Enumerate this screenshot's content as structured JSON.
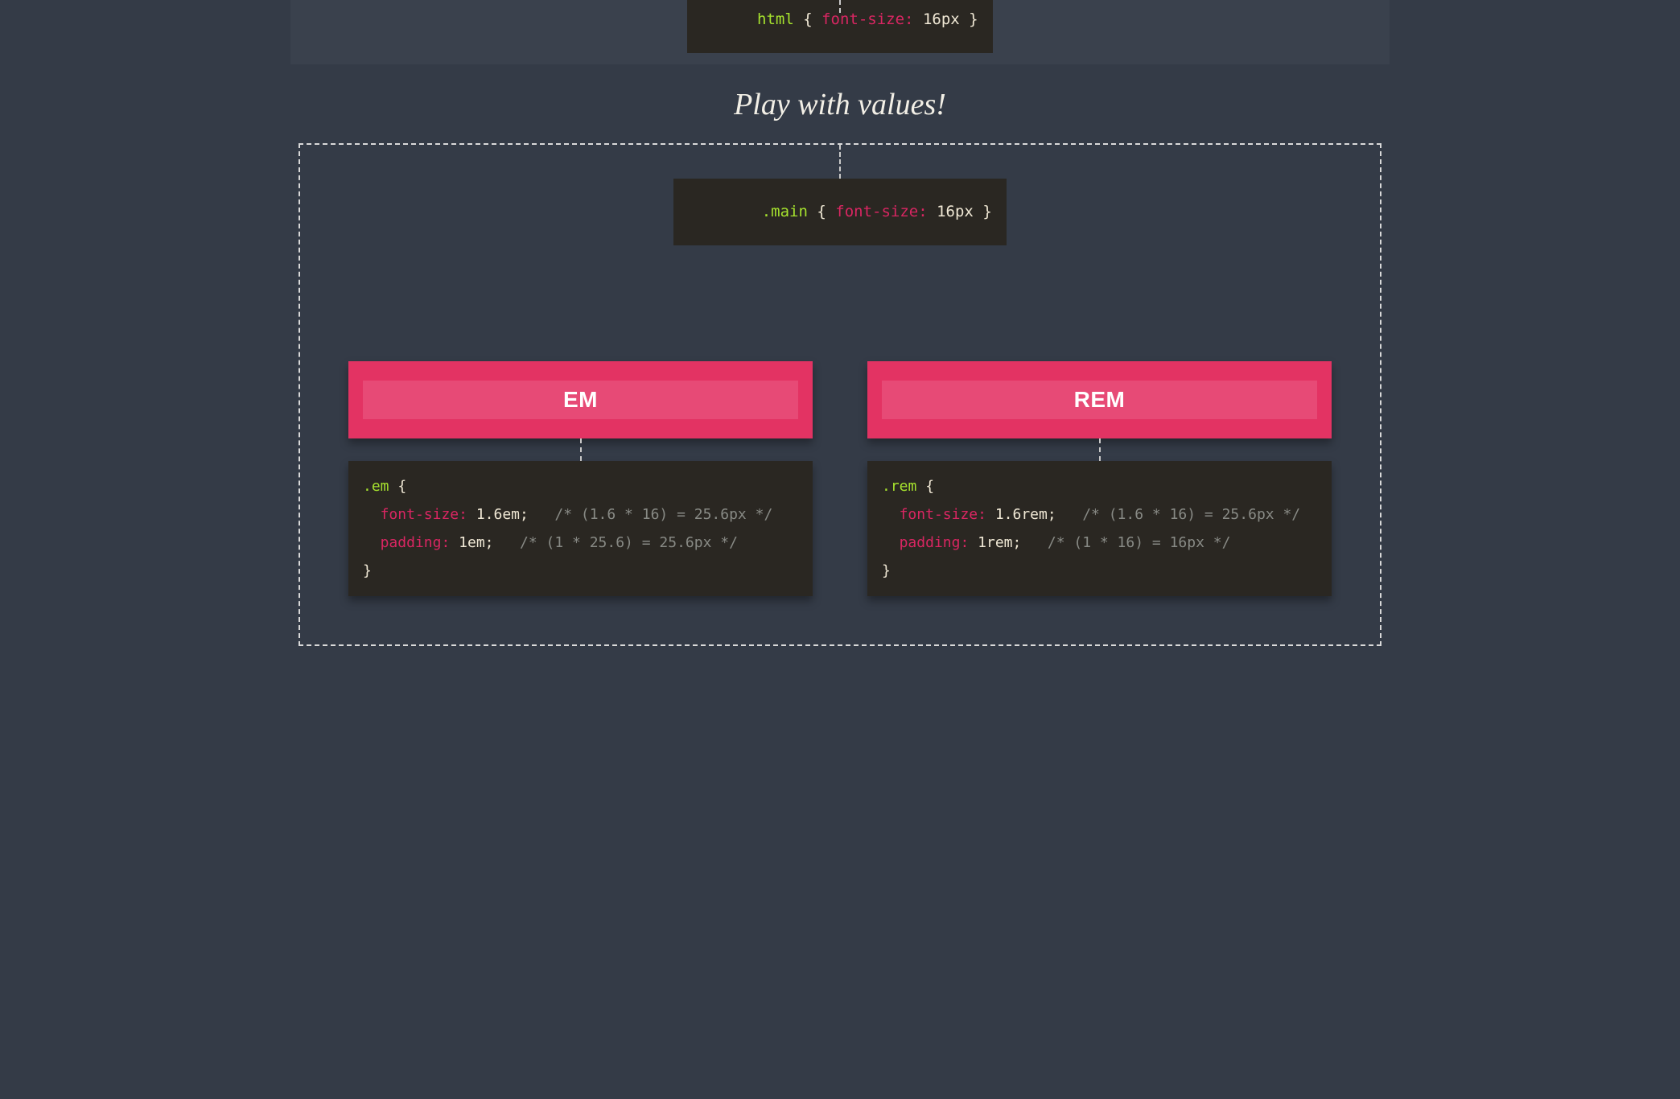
{
  "top_rule": {
    "selector": "html",
    "prop": "font-size:",
    "value": "16px"
  },
  "title": "Play with values!",
  "main_rule": {
    "selector": ".main",
    "prop": "font-size:",
    "value": "16px"
  },
  "em_card": {
    "label": "EM",
    "code": {
      "selector": ".em",
      "lines": [
        {
          "prop": "font-size:",
          "value": "1.6em",
          "comment": "/* (1.6 * 16) = 25.6px */"
        },
        {
          "prop": "padding:",
          "value": "1em",
          "comment": "/* (1 * 25.6) = 25.6px */"
        }
      ]
    }
  },
  "rem_card": {
    "label": "REM",
    "code": {
      "selector": ".rem",
      "lines": [
        {
          "prop": "font-size:",
          "value": "1.6rem",
          "comment": "/* (1.6 * 16) = 25.6px */"
        },
        {
          "prop": "padding:",
          "value": "1rem",
          "comment": "/* (1 * 16) = 16px */"
        }
      ]
    }
  }
}
